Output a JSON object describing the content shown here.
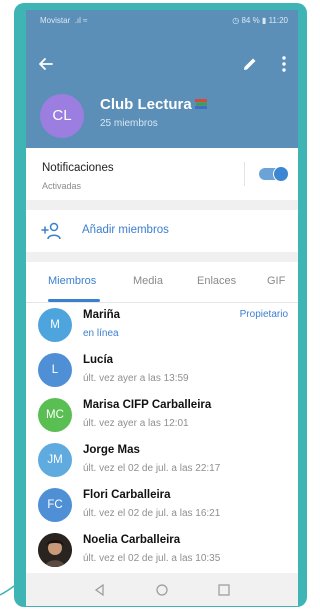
{
  "status_bar": {
    "carrier": "Movistar",
    "battery": "84 %",
    "time": "11:20"
  },
  "group": {
    "initials": "CL",
    "name": "Club Lectura",
    "members_count": "25 miembros",
    "avatar_color": "#9c7ee0"
  },
  "notifications": {
    "label": "Notificaciones",
    "status": "Activadas",
    "enabled": true
  },
  "add_members": {
    "label": "Añadir miembros"
  },
  "tabs": [
    {
      "label": "Miembros",
      "active": true
    },
    {
      "label": "Media",
      "active": false
    },
    {
      "label": "Enlaces",
      "active": false
    },
    {
      "label": "GIF",
      "active": false
    }
  ],
  "members": [
    {
      "initials": "M",
      "name": "Mariña",
      "status": "en línea",
      "role": "Propietario",
      "color": "#4ea4dc"
    },
    {
      "initials": "L",
      "name": "Lucía",
      "status": "últ. vez ayer a las 13:59",
      "role": "",
      "color": "#4f8fd6"
    },
    {
      "initials": "MC",
      "name": "Marisa CIFP Carballeira",
      "status": "últ. vez ayer a las 12:01",
      "role": "",
      "color": "#5abf52"
    },
    {
      "initials": "JM",
      "name": "Jorge Mas",
      "status": "últ. vez el 02 de jul. a las 22:17",
      "role": "",
      "color": "#5faadf"
    },
    {
      "initials": "FC",
      "name": "Flori Carballeira",
      "status": "últ. vez el 02 de jul. a las 16:21",
      "role": "",
      "color": "#4f8fd6"
    },
    {
      "initials": "",
      "name": "Noelia Carballeira",
      "status": "últ. vez el 02 de jul. a las 10:35",
      "role": "",
      "color": "#3a2a20"
    }
  ],
  "colors": {
    "header": "#5b8fb8",
    "accent": "#3b7fcf",
    "frame": "#3fb4b4"
  }
}
